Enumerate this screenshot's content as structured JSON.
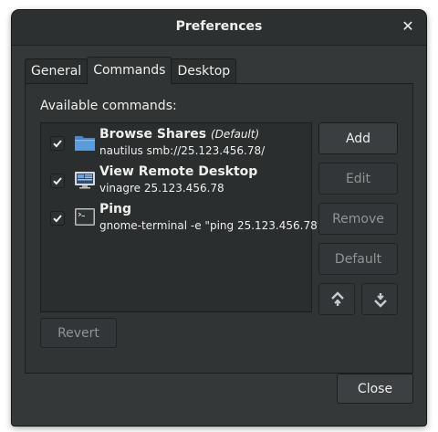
{
  "window": {
    "title": "Preferences"
  },
  "tabs": [
    {
      "label": "General"
    },
    {
      "label": "Commands"
    },
    {
      "label": "Desktop"
    }
  ],
  "commands_tab": {
    "heading": "Available commands:",
    "commands": [
      {
        "name": "Browse Shares",
        "tag": "(Default)",
        "exec": "nautilus smb://25.123.456.78/",
        "checked": true,
        "icon": "folder-icon"
      },
      {
        "name": "View Remote Desktop",
        "tag": "",
        "exec": "vinagre 25.123.456.78",
        "checked": true,
        "icon": "remote-desktop-icon"
      },
      {
        "name": "Ping",
        "tag": "",
        "exec": "gnome-terminal -e \"ping 25.123.456.78\"",
        "checked": true,
        "icon": "terminal-icon"
      }
    ],
    "buttons": {
      "add": "Add",
      "edit": "Edit",
      "remove": "Remove",
      "default": "Default",
      "move_up_icon": "move-up-icon",
      "move_down_icon": "move-down-icon",
      "revert": "Revert"
    }
  },
  "footer": {
    "close": "Close"
  },
  "colors": {
    "window_bg": "#353839",
    "titlebar_bg": "#2d3031",
    "list_bg": "#2b2e2f",
    "folder_blue": "#5b9bd9",
    "text": "#eeeeec",
    "disabled_text": "#919494"
  }
}
